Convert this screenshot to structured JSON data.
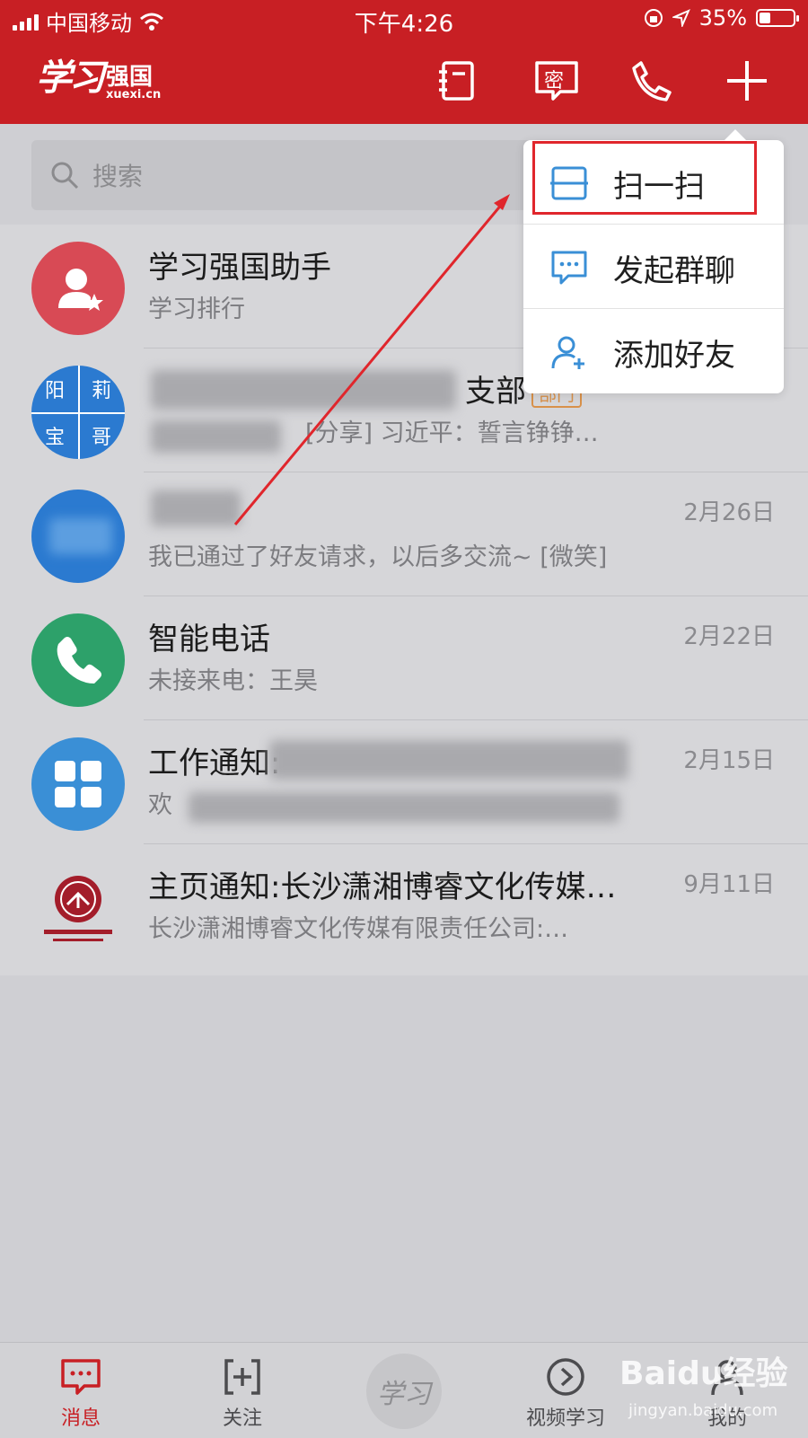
{
  "status": {
    "carrier": "中国移动",
    "time": "下午4:26",
    "battery": "35%"
  },
  "header": {
    "logo_script": "学习",
    "logo_main": "强国",
    "logo_domain": "xuexi.cn",
    "icons": [
      "contacts-book-icon",
      "secret-chat-icon",
      "phone-icon",
      "plus-icon"
    ],
    "secret_glyph": "密"
  },
  "search": {
    "placeholder": "搜索"
  },
  "chats": [
    {
      "title": "学习强国助手",
      "subtitle": "学习排行",
      "date": ""
    },
    {
      "title_visible": "支部",
      "tag": "部门",
      "subtitle_visible": "[分享] 习近平：誓言铮铮…",
      "avatar_chars": [
        "阳",
        "莉",
        "宝",
        "哥"
      ],
      "date": ""
    },
    {
      "title": "",
      "subtitle": "我已通过了好友请求，以后多交流~ [微笑]",
      "date": "2月26日"
    },
    {
      "title": "智能电话",
      "subtitle": "未接来电：王昊",
      "date": "2月22日"
    },
    {
      "title": "工作通知:",
      "subtitle": "欢",
      "date": "2月15日"
    },
    {
      "title": "主页通知:长沙潇湘博睿文化传媒…",
      "subtitle": "长沙潇湘博睿文化传媒有限责任公司:…",
      "date": "9月11日"
    }
  ],
  "menu": {
    "items": [
      {
        "label": "扫一扫",
        "icon": "scan-icon"
      },
      {
        "label": "发起群聊",
        "icon": "group-chat-icon"
      },
      {
        "label": "添加好友",
        "icon": "add-friend-icon"
      }
    ]
  },
  "tabbar": {
    "items": [
      {
        "label": "消息",
        "icon": "message-icon",
        "active": true
      },
      {
        "label": "关注",
        "icon": "follow-icon",
        "active": false
      },
      {
        "label": "视频学习",
        "icon": "video-icon",
        "active": false
      },
      {
        "label": "我的",
        "icon": "profile-icon",
        "active": false
      }
    ],
    "center_logo": "学习"
  },
  "watermark": {
    "brand": "Baidu经验",
    "domain": "jingyan.baidu.com"
  },
  "colors": {
    "brand_red": "#c81f24",
    "menu_icon_blue": "#3a8fd6",
    "highlight": "#e0262c"
  }
}
